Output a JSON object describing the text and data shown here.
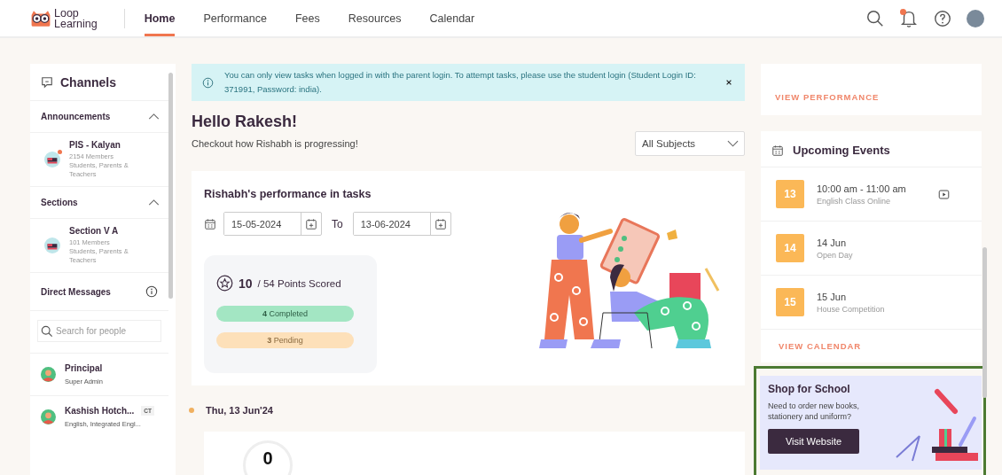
{
  "header": {
    "logo": {
      "line1": "Loop",
      "line2": "Learning"
    },
    "nav": [
      {
        "label": "Home",
        "selected": true
      },
      {
        "label": "Performance",
        "selected": false
      },
      {
        "label": "Fees",
        "selected": false
      },
      {
        "label": "Resources",
        "selected": false
      },
      {
        "label": "Calendar",
        "selected": false
      }
    ],
    "notifications_unread": true
  },
  "sidebar": {
    "title": "Channels",
    "groups": [
      {
        "title": "Announcements",
        "expanded": true,
        "channels": [
          {
            "name": "PIS - Kalyan",
            "members": "2154 Members",
            "audience": "Students, Parents & Teachers",
            "unread": true
          }
        ]
      },
      {
        "title": "Sections",
        "expanded": true,
        "channels": [
          {
            "name": "Section V A",
            "members": "101 Members",
            "audience": "Students, Parents & Teachers",
            "unread": false
          }
        ]
      }
    ],
    "direct_messages": {
      "title": "Direct Messages",
      "search": {
        "placeholder": "Search for people"
      },
      "contacts": [
        {
          "name": "Principal",
          "role": "Super Admin"
        },
        {
          "name": "Kashish Hotch...",
          "badge": "CT",
          "role": "English, Integrated Engl..."
        }
      ]
    }
  },
  "notice": {
    "text": "You can only view tasks when logged in with the parent login. To attempt tasks, please use the student login (Student Login ID: 371991, Password: india)."
  },
  "greeting": {
    "title": "Hello Rakesh!",
    "subtitle": "Checkout how Rishabh is progressing!"
  },
  "subject_select": {
    "value": "All Subjects"
  },
  "performance": {
    "title": "Rishabh's performance in tasks",
    "from": "15-05-2024",
    "separator": "To",
    "to": "13-06-2024",
    "score": "10",
    "score_label": "/ 54 Points Scored",
    "statuses": [
      {
        "kind": "completed",
        "count": "4",
        "label": "Completed"
      },
      {
        "kind": "pending",
        "count": "3",
        "label": "Pending"
      }
    ]
  },
  "timeline": {
    "date": "Thu, 13 Jun'24",
    "value": "0"
  },
  "right": {
    "view_performance": "VIEW PERFORMANCE",
    "events": {
      "title": "Upcoming Events",
      "items": [
        {
          "day": "13",
          "title": "10:00 am - 11:00 am",
          "subtitle": "English Class Online",
          "online": true
        },
        {
          "day": "14",
          "title": "14 Jun",
          "subtitle": "Open Day",
          "online": false
        },
        {
          "day": "15",
          "title": "15 Jun",
          "subtitle": "House Competition",
          "online": false
        }
      ],
      "link": "VIEW CALENDAR"
    },
    "shop": {
      "title": "Shop for School",
      "text": "Need to order new books, stationery and uniform?",
      "button": "Visit Website"
    }
  }
}
